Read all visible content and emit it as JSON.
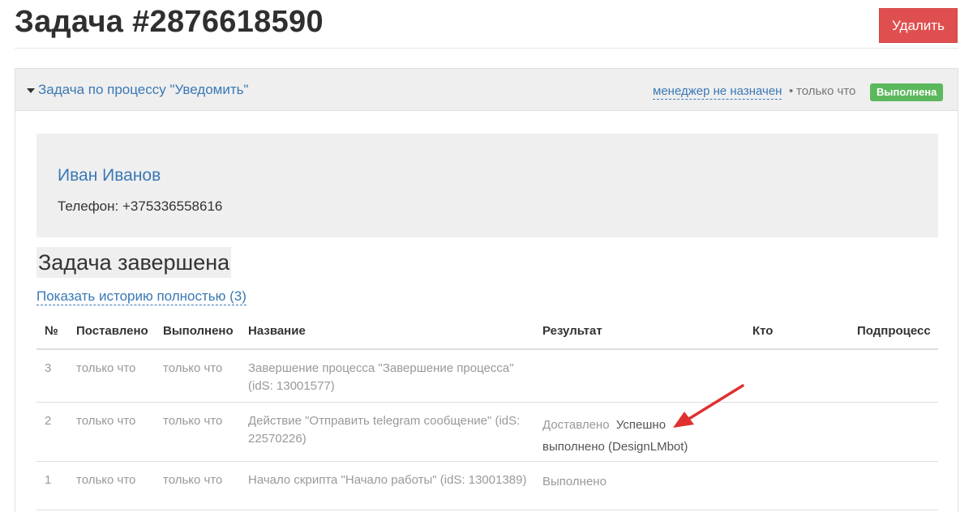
{
  "page": {
    "title": "Задача #2876618590",
    "delete_label": "Удалить"
  },
  "panel": {
    "process_link": "Задача по процессу \"Уведомить\"",
    "manager_link": "менеджер не назначен",
    "separator": "•",
    "time": "только что",
    "status_badge": "Выполнена"
  },
  "contact": {
    "name": "Иван Иванов",
    "phone_label": "Телефон: ",
    "phone_value": "+375336558616"
  },
  "task": {
    "status": "Задача завершена",
    "history_link": "Показать историю полностью (3)"
  },
  "table": {
    "headers": [
      "№",
      "Поставлено",
      "Выполнено",
      "Название",
      "Результат",
      "Кто",
      "Подпроцесс"
    ],
    "rows": [
      {
        "num": "3",
        "posted": "только что",
        "done": "только что",
        "name": "Завершение процесса \"Завершение процесса\" (idS: 13001577)",
        "result_prefix": "",
        "result_main": "",
        "who": "",
        "subprocess": ""
      },
      {
        "num": "2",
        "posted": "только что",
        "done": "только что",
        "name": "Действие \"Отправить telegram сообщение\" (idS: 22570226)",
        "result_prefix": "Доставлено",
        "result_main": "Успешно выполнено (DesignLMbot)",
        "who": "",
        "subprocess": ""
      },
      {
        "num": "1",
        "posted": "только что",
        "done": "только что",
        "name": "Начало скрипта \"Начало работы\" (idS: 13001389)",
        "result_prefix": "Выполнено",
        "result_main": "",
        "who": "",
        "subprocess": ""
      }
    ]
  },
  "colors": {
    "accent_link": "#3a78b5",
    "delete_button": "#e04f4f",
    "status_success": "#5cb85c",
    "annotation_arrow": "#e03030"
  },
  "icons": {
    "panel_toggle": "caret-down-icon",
    "annotation": "red-arrow-annotation"
  }
}
